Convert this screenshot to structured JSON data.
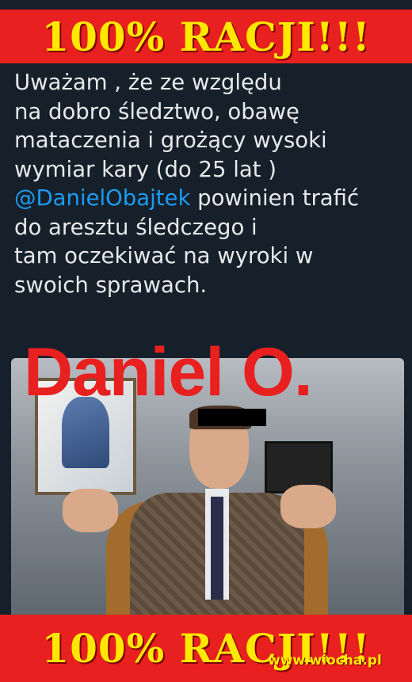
{
  "banner_top": "100% RACJI!!!",
  "banner_bottom": "100% RACJI!!!",
  "tweet": {
    "line1": "Uważam , że ze względu",
    "line2": "na dobro śledztwo, obawę",
    "line3": "mataczenia i grożący wysoki",
    "line4": "wymiar kary (do 25 lat )",
    "mention": "@DanielObajtek",
    "line5_rest": " powinien trafić",
    "line6": "do aresztu śledczego i",
    "line7": "tam oczekiwać na wyroki w",
    "line8": "swoich sprawach."
  },
  "overlay_title": "Daniel O.",
  "watermark": "www.wiocha.pl",
  "colors": {
    "background": "#15202b",
    "banner_red": "#e8201f",
    "banner_text_yellow": "#ffe800",
    "tweet_text": "#e7e9ea",
    "mention_blue": "#1d9bf0"
  }
}
